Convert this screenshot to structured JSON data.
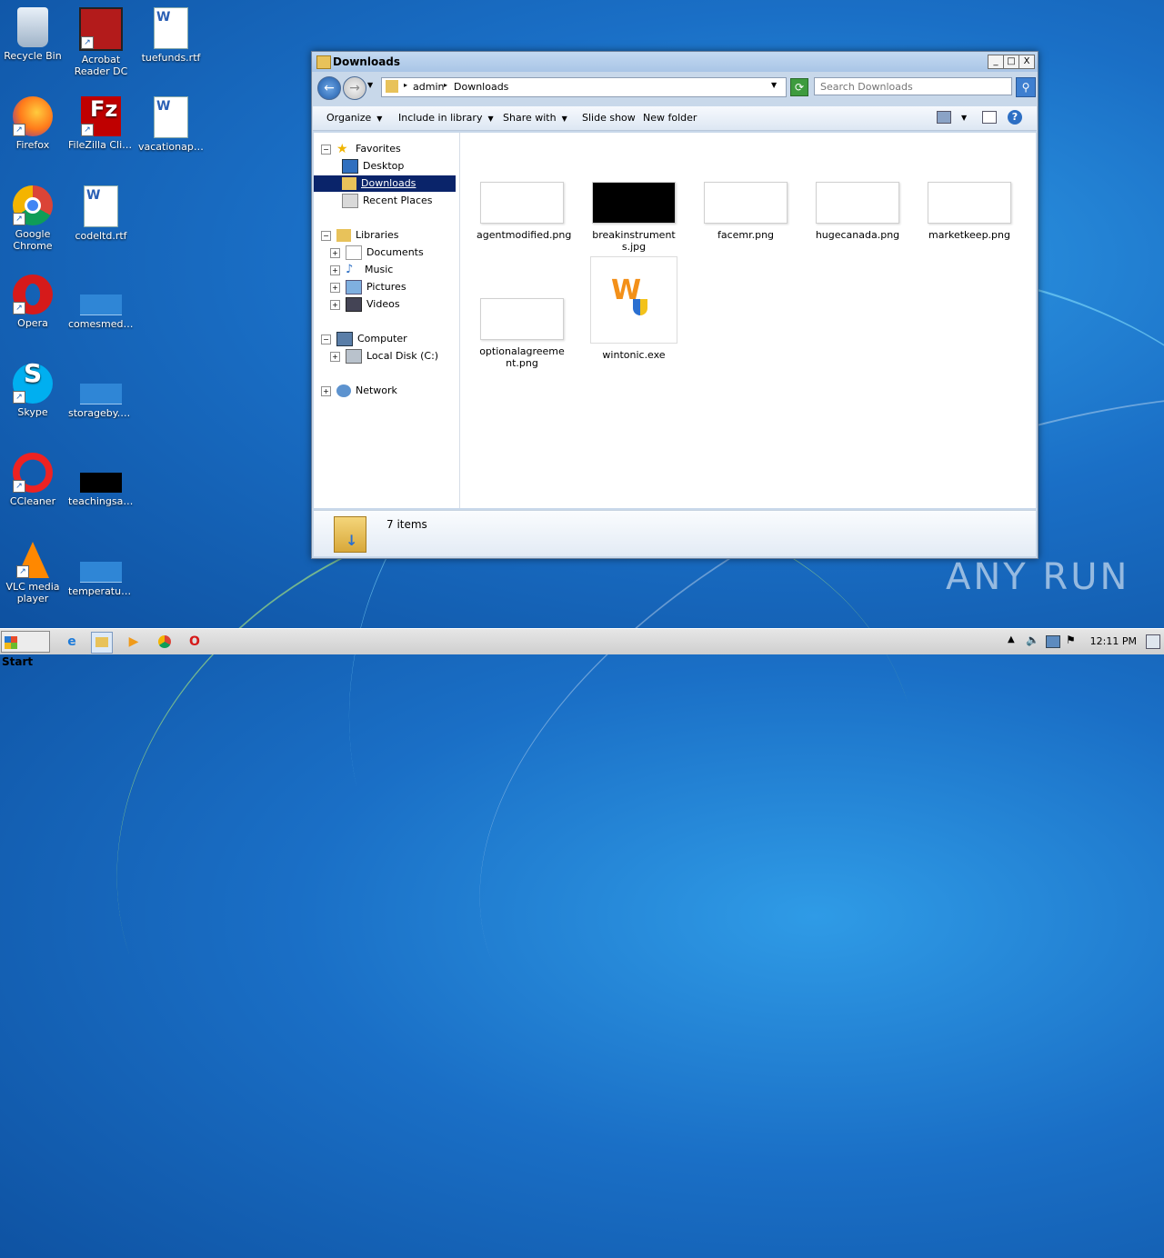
{
  "desktop": {
    "icons": [
      {
        "label": "Recycle Bin"
      },
      {
        "label": "Acrobat\nReader DC"
      },
      {
        "label": "tuefunds.rtf"
      },
      {
        "label": "Firefox"
      },
      {
        "label": "FileZilla Client"
      },
      {
        "label": "vacationapr..."
      },
      {
        "label": "Google Chrome"
      },
      {
        "label": "codeltd.rtf"
      },
      {
        "label": "Opera"
      },
      {
        "label": "comesmediu..."
      },
      {
        "label": "Skype"
      },
      {
        "label": "storageby.png"
      },
      {
        "label": "CCleaner"
      },
      {
        "label": "teachingsat..."
      },
      {
        "label": "VLC media player"
      },
      {
        "label": "temperatur..."
      }
    ]
  },
  "window": {
    "title": "Downloads",
    "controls": {
      "minimize": "_",
      "maximize": "□",
      "close": "X"
    },
    "address": {
      "segment1": "admin",
      "segment2": "Downloads"
    },
    "search_placeholder": "Search Downloads",
    "toolbar": {
      "organize": "Organize",
      "include": "Include in library",
      "share": "Share with",
      "slideshow": "Slide show",
      "newfolder": "New folder"
    },
    "nav": {
      "favorites": "Favorites",
      "desktop": "Desktop",
      "downloads": "Downloads",
      "recent": "Recent Places",
      "libraries": "Libraries",
      "documents": "Documents",
      "music": "Music",
      "pictures": "Pictures",
      "videos": "Videos",
      "computer": "Computer",
      "localdisk": "Local Disk (C:)",
      "network": "Network"
    },
    "files": [
      {
        "name": "agentmodified.png"
      },
      {
        "name": "breakinstruments.jpg"
      },
      {
        "name": "facemr.png"
      },
      {
        "name": "hugecanada.png"
      },
      {
        "name": "marketkeep.png"
      },
      {
        "name": "optionalagreement.png"
      },
      {
        "name": "wintonic.exe"
      }
    ],
    "status": "7 items"
  },
  "taskbar": {
    "start": "Start",
    "clock": "12:11 PM"
  },
  "watermark": "ANY RUN"
}
